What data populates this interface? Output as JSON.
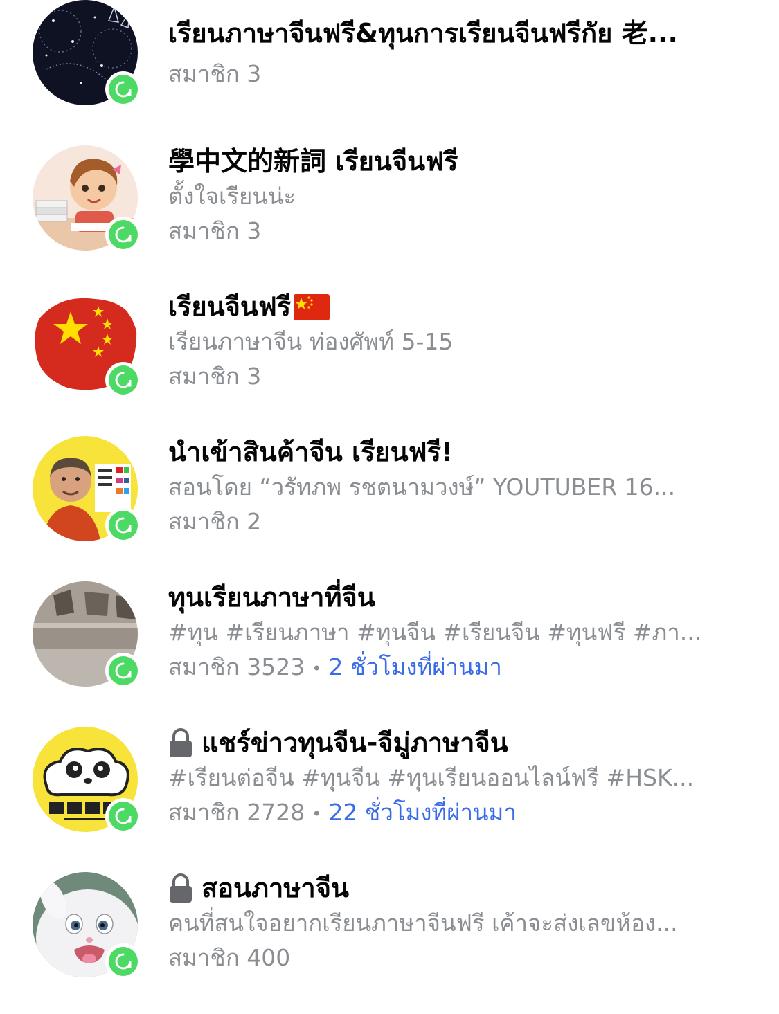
{
  "groups": [
    {
      "title": "เรียนภาษาจีนฟรี&ทุนการเรียนจีนฟรีกัย 老...",
      "subtitle": "",
      "members": "สมาชิก 3",
      "time": "",
      "locked": false,
      "avatar": "constellation-rabbit-dark"
    },
    {
      "title": "學中文的新詞 เรียนจีนฟรี",
      "subtitle": "ตั้งใจเรียนน่ะ",
      "members": "สมาชิก 3",
      "time": "",
      "locked": false,
      "avatar": "cartoon-girl-studying"
    },
    {
      "title": "เรียนจีนฟรี",
      "subtitle": "เรียนภาษาจีน ท่องศัพท์ 5-15",
      "members": "สมาชิก 3",
      "time": "",
      "locked": false,
      "flag": "china-flag-icon",
      "avatar": "china-flag-map"
    },
    {
      "title": "นำเข้าสินค้าจีน เรียนฟรี!",
      "subtitle": "สอนโดย “วรัทภพ รชตนามวงษ์” YOUTUBER 16...",
      "members": "สมาชิก 2",
      "time": "",
      "locked": false,
      "avatar": "man-yellow-background"
    },
    {
      "title": "ทุนเรียนภาษาที่จีน",
      "subtitle": "#ทุน #เรียนภาษา #ทุนจีน #เรียนจีน #ทุนฟรี #ภา...",
      "members": "สมาชิก 3523",
      "time": "2 ชั่วโมงที่ผ่านมา",
      "locked": false,
      "avatar": "experience-sign"
    },
    {
      "title": "แชร์ข่าวทุนจีน-จีมู่ภาษาจีน",
      "subtitle": "#เรียนต่อจีน #ทุนจีน #ทุนเรียนออนไลน์ฟรี #HSK...",
      "members": "สมาชิก 2728",
      "time": "22 ชั่วโมงที่ผ่านมา",
      "locked": true,
      "avatar": "panda-cloud-yellow"
    },
    {
      "title": "สอนภาษาจีน",
      "subtitle": "คนที่สนใจอยากเรียนภาษาจีนฟรี เค้าจะส่งเลขห้อง...",
      "members": "สมาชิก 400",
      "time": "",
      "locked": true,
      "avatar": "white-bunny-cartoon"
    }
  ],
  "dot_separator": "•",
  "colors": {
    "title": "#050505",
    "secondary": "#8a8d91",
    "time": "#3b6ce8",
    "badge": "#4cd964"
  }
}
